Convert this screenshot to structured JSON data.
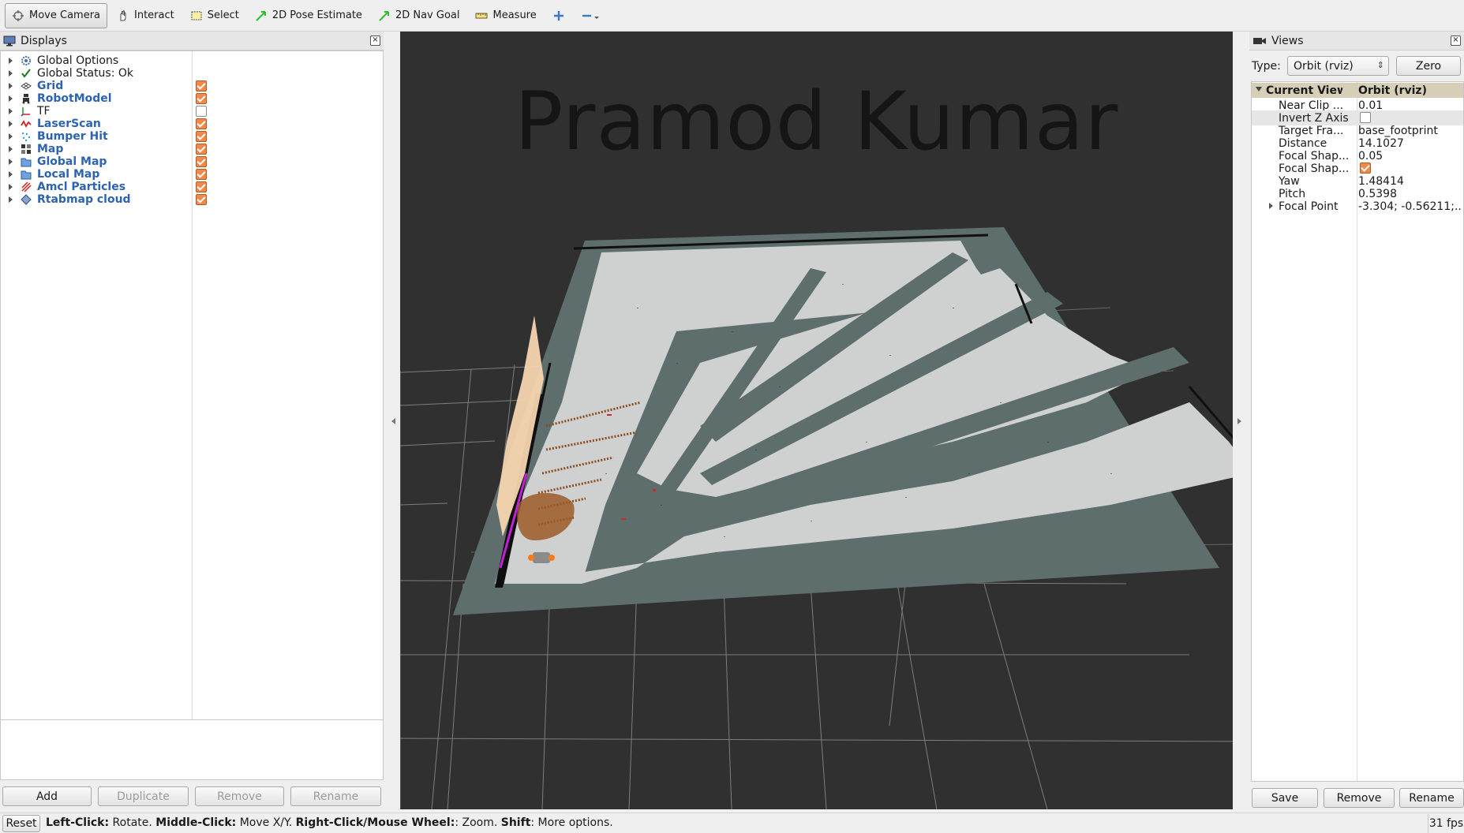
{
  "toolbar": {
    "move_camera": "Move Camera",
    "interact": "Interact",
    "select": "Select",
    "pose_estimate": "2D Pose Estimate",
    "nav_goal": "2D Nav Goal",
    "measure": "Measure"
  },
  "displays": {
    "title": "Displays",
    "items": [
      {
        "label": "Global Options",
        "icon": "gear-icon",
        "checked": null,
        "plugin": false
      },
      {
        "label": "Global Status: Ok",
        "icon": "check-icon",
        "checked": null,
        "plugin": false
      },
      {
        "label": "Grid",
        "icon": "grid-icon",
        "checked": true,
        "plugin": true
      },
      {
        "label": "RobotModel",
        "icon": "robot-icon",
        "checked": true,
        "plugin": true
      },
      {
        "label": "TF",
        "icon": "axes-icon",
        "checked": false,
        "plugin": false
      },
      {
        "label": "LaserScan",
        "icon": "laser-icon",
        "checked": true,
        "plugin": true
      },
      {
        "label": "Bumper Hit",
        "icon": "points-icon",
        "checked": true,
        "plugin": true
      },
      {
        "label": "Map",
        "icon": "map-icon",
        "checked": true,
        "plugin": true
      },
      {
        "label": "Global Map",
        "icon": "folder-icon",
        "checked": true,
        "plugin": true
      },
      {
        "label": "Local Map",
        "icon": "folder-icon",
        "checked": true,
        "plugin": true
      },
      {
        "label": "Amcl Particles",
        "icon": "arrows-icon",
        "checked": true,
        "plugin": true
      },
      {
        "label": "Rtabmap cloud",
        "icon": "cloud-icon",
        "checked": true,
        "plugin": true
      }
    ],
    "buttons": {
      "add": "Add",
      "duplicate": "Duplicate",
      "remove": "Remove",
      "rename": "Rename"
    }
  },
  "viewport": {
    "overlay_text": "Pramod Kumar"
  },
  "views": {
    "title": "Views",
    "type_label": "Type:",
    "type_value": "Orbit (rviz)",
    "zero_label": "Zero",
    "header": {
      "key": "Current View",
      "value": "Orbit (rviz)"
    },
    "rows": [
      {
        "key": "Near Clip ...",
        "value": "0.01"
      },
      {
        "key": "Invert Z Axis",
        "value": "",
        "checkbox": false
      },
      {
        "key": "Target Fra...",
        "value": "base_footprint"
      },
      {
        "key": "Distance",
        "value": "14.1027"
      },
      {
        "key": "Focal Shap...",
        "value": "0.05"
      },
      {
        "key": "Focal Shap...",
        "value": "",
        "checkbox": true
      },
      {
        "key": "Yaw",
        "value": "1.48414"
      },
      {
        "key": "Pitch",
        "value": "0.5398"
      },
      {
        "key": "Focal Point",
        "value": "-3.304; -0.56211;..."
      }
    ],
    "buttons": {
      "save": "Save",
      "remove": "Remove",
      "rename": "Rename"
    }
  },
  "statusbar": {
    "reset": "Reset",
    "left_click": "Left-Click:",
    "left_click_desc": " Rotate. ",
    "middle_click": "Middle-Click:",
    "middle_click_desc": " Move X/Y. ",
    "right_click": "Right-Click/Mouse Wheel:",
    "right_click_desc": ": Zoom. ",
    "shift": "Shift",
    "shift_desc": ": More options.",
    "fps": "31 fps"
  },
  "colors": {
    "plugin_label": "#2d63b1",
    "checkbox_on": "#f08a4b",
    "viewport_bg": "#303030",
    "map_free": "#d0d0d0",
    "map_unknown": "#5e6e6c"
  }
}
